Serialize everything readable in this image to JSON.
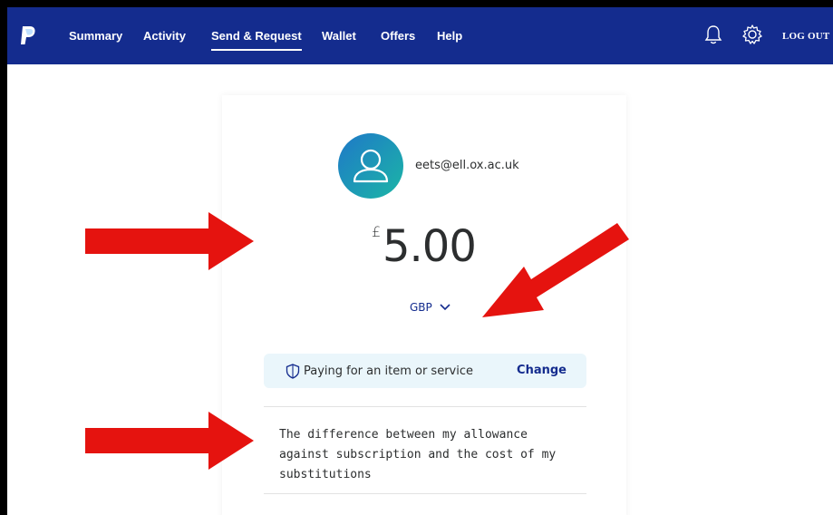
{
  "nav": {
    "items": [
      {
        "label": "Summary"
      },
      {
        "label": "Activity"
      },
      {
        "label": "Send & Request"
      },
      {
        "label": "Wallet"
      },
      {
        "label": "Offers"
      },
      {
        "label": "Help"
      }
    ],
    "logout": "LOG OUT",
    "icons": [
      "paypal-logo",
      "bell-icon",
      "gear-icon"
    ]
  },
  "recipient": {
    "email": "eets@ell.ox.ac.uk"
  },
  "amount": {
    "symbol": "£",
    "value": "5.00",
    "currency": "GBP"
  },
  "payment_type": {
    "label": "Paying for an item or service",
    "action": "Change"
  },
  "note": {
    "text": "The difference between my allowance against subscription and the cost of my substitutions"
  },
  "colors": {
    "nav": "#142c8e",
    "accent": "#142c8e",
    "panel": "#eaf6fb",
    "arrow": "#e5130f"
  }
}
